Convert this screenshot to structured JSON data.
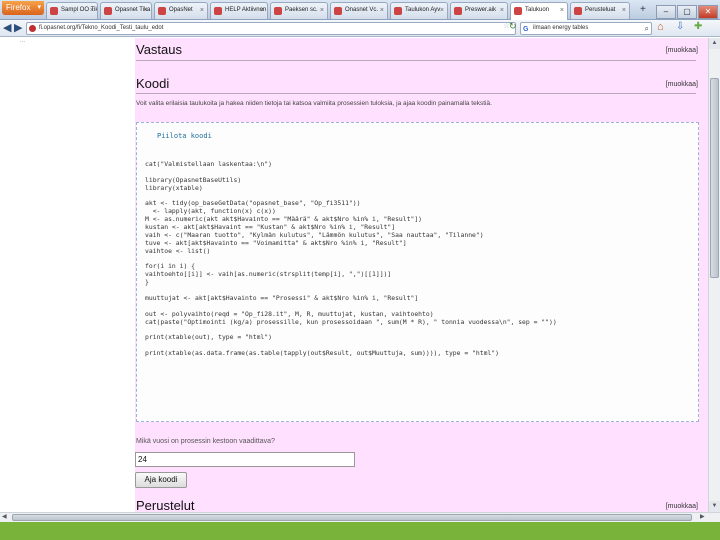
{
  "browser": {
    "menu_button": "Firefox",
    "tabs": [
      {
        "label": "Firefox",
        "favicon_color": "#e07a2a"
      },
      {
        "label": "Sampl OO Tikon",
        "favicon_color": "#c44"
      },
      {
        "label": "Opasnet Tika",
        "favicon_color": "#c44"
      },
      {
        "label": "OpasNet",
        "favicon_color": "#c44"
      },
      {
        "label": "HELP Aktiivnon",
        "favicon_color": "#c44"
      },
      {
        "label": "Paeksen sc.",
        "favicon_color": "#c44"
      },
      {
        "label": "Onasnet Vc.",
        "favicon_color": "#c44"
      },
      {
        "label": "Taulukon Ayv",
        "favicon_color": "#c44"
      },
      {
        "label": "Preswer.aik",
        "favicon_color": "#c44"
      },
      {
        "label": "Talukuon",
        "favicon_color": "#c44",
        "active": true
      },
      {
        "label": "Perusteluat",
        "favicon_color": "#c44"
      }
    ],
    "url": "fi.opasnet.org/fi/Tekno_Koodi_Testi_taulu_edot",
    "search_text": "ilmaan energy tables"
  },
  "page": {
    "left_stub": "...",
    "section_vastaus": {
      "title": "Vastaus",
      "edit": "[muokkaa]"
    },
    "section_koodi": {
      "title": "Koodi",
      "edit": "[muokkaa]",
      "description": "Voit valita erilaisia taulukoita ja hakea niiden tietoja tai katsoa valmiita prosessien tuloksia, ja ajaa koodin painamalla tekstiä."
    },
    "code": {
      "title": "Piilota koodi",
      "lines": [
        "",
        "cat(\"Valmistellaan laskentaa:\\n\")",
        "",
        "library(OpasnetBaseUtils)",
        "library(xtable)",
        "",
        "akt <- tidy(op_baseGetData(\"opasnet_base\", \"Op_fi3511\"))",
        "  <- lapply(akt, function(x) c(x))",
        "M <- as.numeric(akt akt$Havainto == \"Määrä\" & akt$Nro %in% i, \"Result\"])",
        "kustan <- akt[akt$Havaint == \"Kustan\" & akt$Nro %in% i, \"Result\"]",
        "vaih <- c(\"Maaran tuotto\", \"Kylmän kulutus\", \"Lämmön kulutus\", \"Saa nauttaa\", \"Tilanne\")",
        "tuve <- akt[akt$Havainto == \"Voimamitta\" & akt$Nro %in% i, \"Result\"]",
        "vaihtoe <- list()",
        "",
        "for(i in i) {",
        "vaihtoehto[[i]] <- vaih[as.numeric(strsplit(temp[i], \",\")[[1]])]",
        "}",
        "",
        "muuttujat <- akt[akt$Havainto == \"Prosessi\" & akt$Nro %in% i, \"Result\"]",
        "",
        "out <- polyvaihto(reqd = \"Op_fi28.it\", M, R, muuttujat, kustan, vaihtoehto)",
        "cat(paste(\"Optimointi (kg/a) prosessille, kun prosessoidaan \", sum(M * R), \" tonnia vuodessa\\n\", sep = \"\"))",
        "",
        "print(xtable(out), type = \"html\")",
        "",
        "print(xtable(as.data.frame(as.table(tapply(out$Result, out$Muuttuja, sum)))), type = \"html\")"
      ]
    },
    "question_label": "Mikä vuosi on prosessin kestoon vaadittava?",
    "input_value": "24",
    "run_button": "Aja koodi",
    "section_perustelut": {
      "title": "Perustelut",
      "edit": "[muokkaa]"
    }
  }
}
